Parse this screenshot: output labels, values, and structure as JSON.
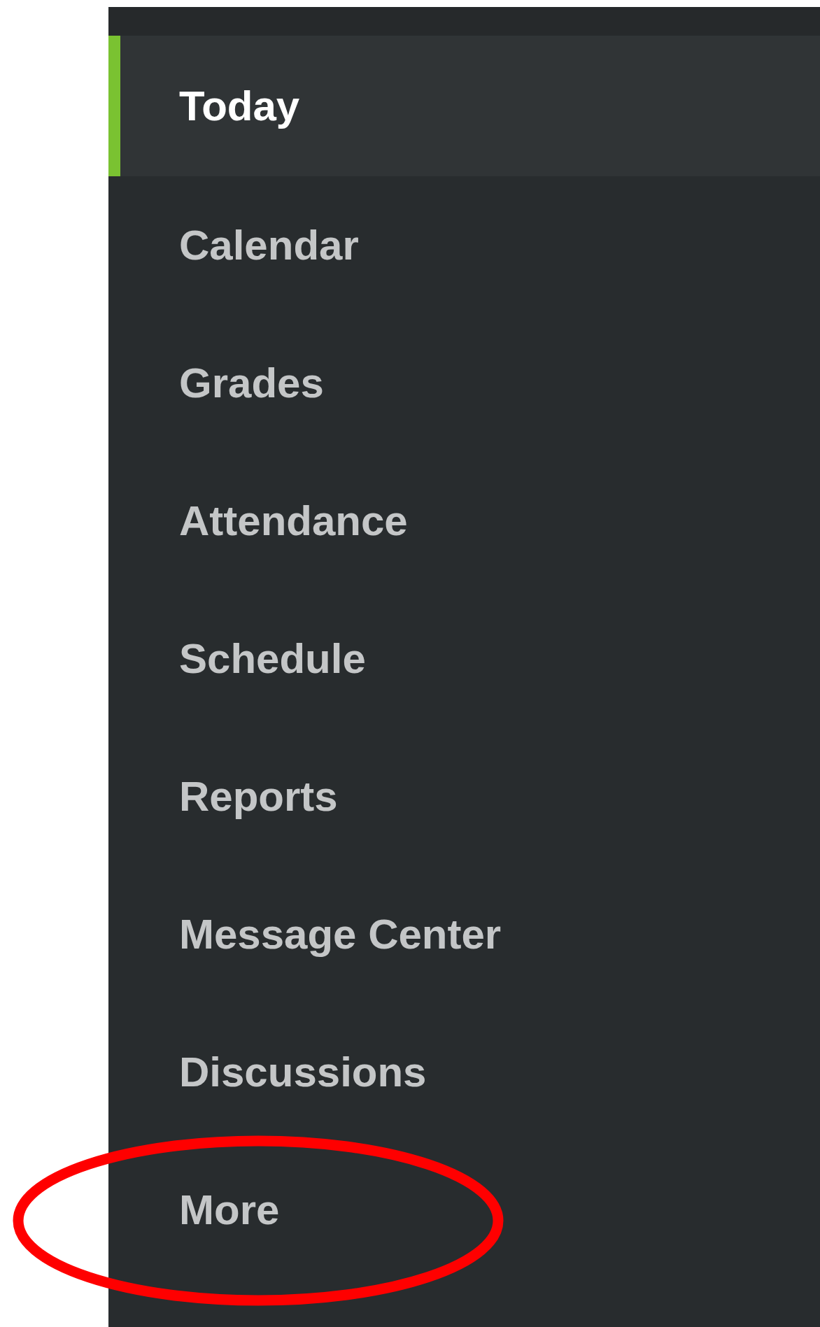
{
  "sidebar": {
    "items": [
      {
        "label": "Today",
        "selected": true,
        "circled": false
      },
      {
        "label": "Calendar",
        "selected": false,
        "circled": false
      },
      {
        "label": "Grades",
        "selected": false,
        "circled": false
      },
      {
        "label": "Attendance",
        "selected": false,
        "circled": false
      },
      {
        "label": "Schedule",
        "selected": false,
        "circled": false
      },
      {
        "label": "Reports",
        "selected": false,
        "circled": false
      },
      {
        "label": "Message Center",
        "selected": false,
        "circled": false
      },
      {
        "label": "Discussions",
        "selected": false,
        "circled": false
      },
      {
        "label": "More",
        "selected": false,
        "circled": true
      }
    ]
  }
}
